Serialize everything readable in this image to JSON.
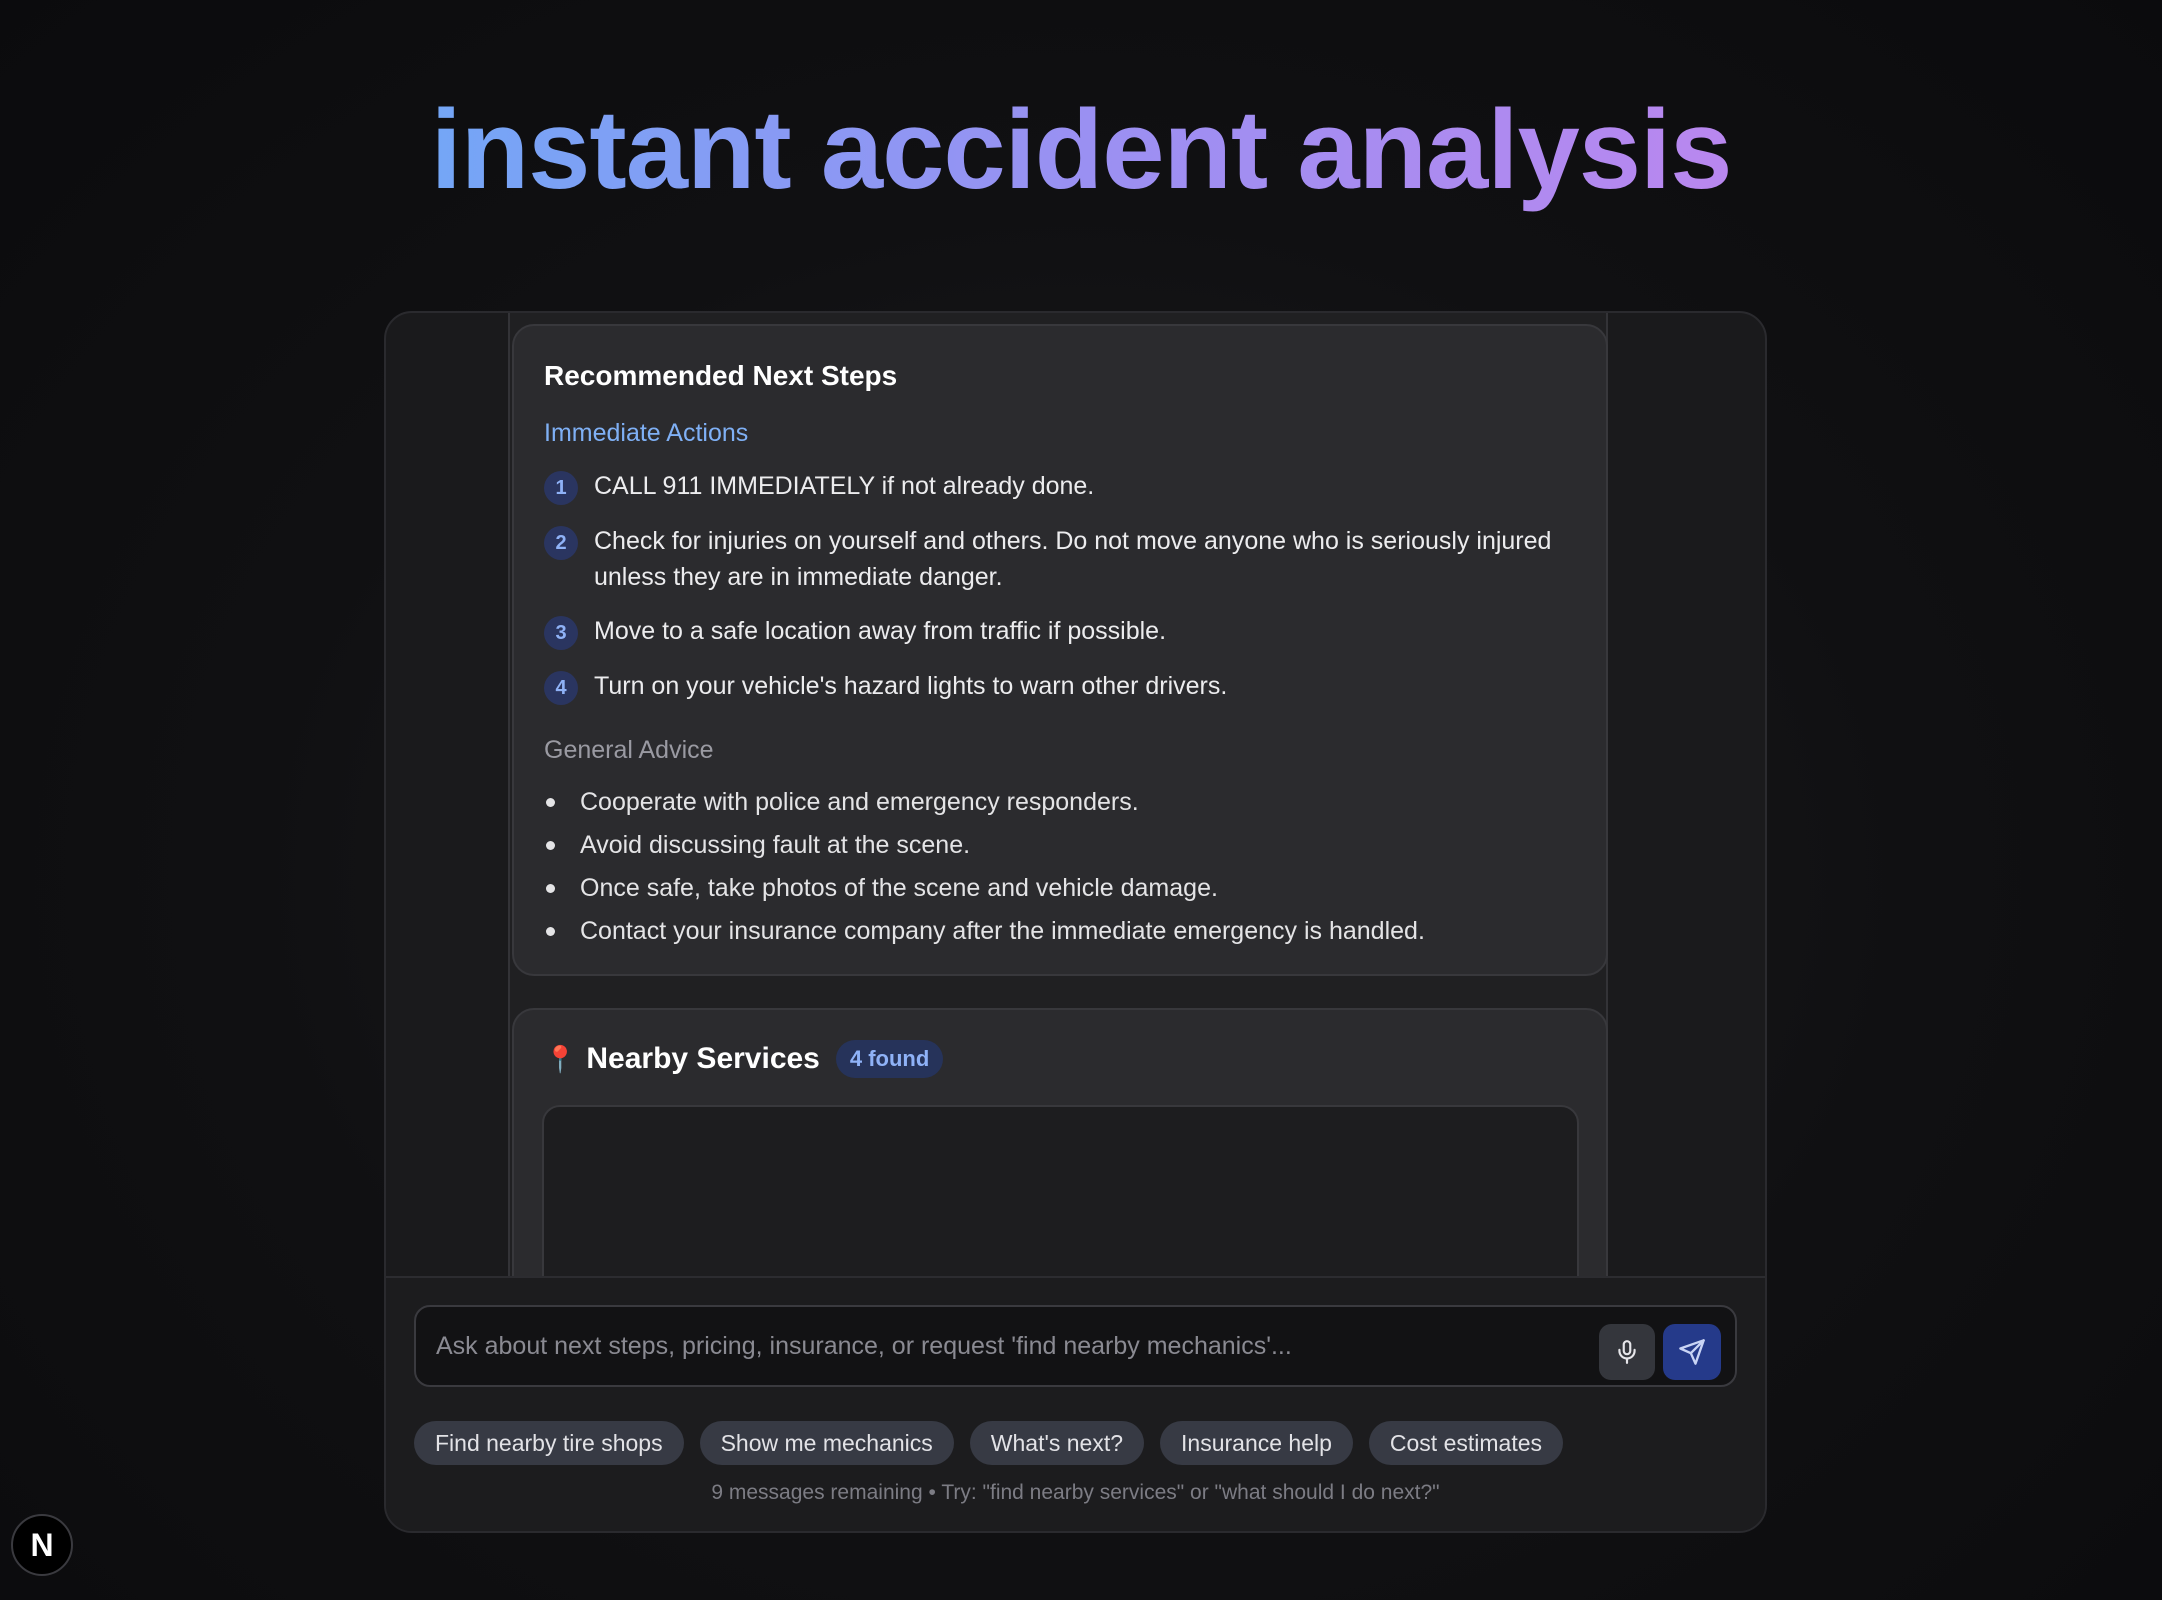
{
  "hero": {
    "title": "instant accident analysis"
  },
  "steps_card": {
    "title": "Recommended Next Steps",
    "immediate_heading": "Immediate Actions",
    "immediate_actions": [
      {
        "num": "1",
        "text": "CALL 911 IMMEDIATELY if not already done."
      },
      {
        "num": "2",
        "text": "Check for injuries on yourself and others. Do not move anyone who is seriously injured unless they are in immediate danger."
      },
      {
        "num": "3",
        "text": "Move to a safe location away from traffic if possible."
      },
      {
        "num": "4",
        "text": "Turn on your vehicle's hazard lights to warn other drivers."
      }
    ],
    "general_heading": "General Advice",
    "general_advice": [
      "Cooperate with police and emergency responders.",
      "Avoid discussing fault at the scene.",
      "Once safe, take photos of the scene and vehicle damage.",
      "Contact your insurance company after the immediate emergency is handled."
    ]
  },
  "services_card": {
    "icon": "map-pin-icon",
    "title": "Nearby Services",
    "badge": "4 found"
  },
  "input": {
    "placeholder": "Ask about next steps, pricing, insurance, or request 'find nearby mechanics'...",
    "value": ""
  },
  "chips": [
    "Find nearby tire shops",
    "Show me mechanics",
    "What's next?",
    "Insurance help",
    "Cost estimates"
  ],
  "footer": {
    "remaining": "9 messages remaining",
    "separator": "•",
    "hint": "Try: \"find nearby services\" or \"what should I do next?\""
  },
  "n_badge": {
    "letter": "N"
  },
  "colors": {
    "gradient_start": "#74a6f6",
    "gradient_end": "#b987ef",
    "accent_blue": "#7fb0f5",
    "send_button": "#253a8a"
  }
}
